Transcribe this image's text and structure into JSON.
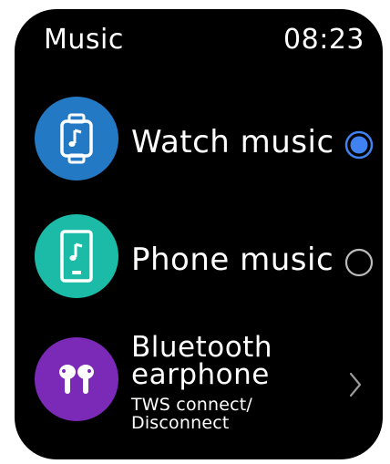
{
  "header": {
    "title": "Music",
    "time": "08:23"
  },
  "options": [
    {
      "label": "Watch music",
      "icon": "watch-music-icon",
      "selected": true
    },
    {
      "label": "Phone music",
      "icon": "phone-music-icon",
      "selected": false
    }
  ],
  "bluetooth": {
    "title_line1": "Bluetooth",
    "title_line2": "earphone",
    "sub_line1": "TWS connect/",
    "sub_line2": "Disconnect",
    "icon": "earbuds-icon"
  },
  "colors": {
    "background": "#000000",
    "watch_music_icon_bg": "#2479c4",
    "phone_music_icon_bg": "#1cbba7",
    "bluetooth_icon_bg": "#7b2ab8",
    "radio_selected": "#3f82f0",
    "radio_unselected": "#bbbbbb"
  }
}
